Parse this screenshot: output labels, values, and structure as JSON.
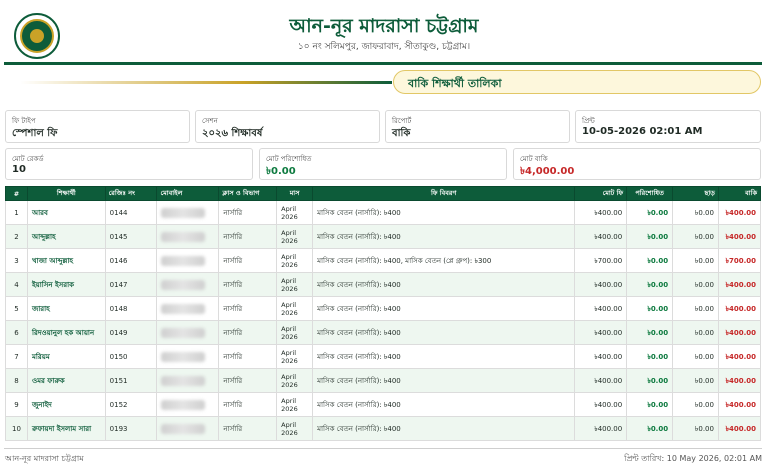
{
  "header": {
    "title": "আন-নূর মাদরাসা চট্টগ্রাম",
    "address": "১০ নং সলিমপুর, জাফরাবাদ, সীতাকুণ্ড, চট্টগ্রাম।"
  },
  "report": {
    "title": "বাকি শিক্ষার্থী তালিকা"
  },
  "filters": {
    "fee_type_label": "ফি টাইপ",
    "fee_type": "স্পেশাল ফি",
    "session_label": "সেশন",
    "session": "২০২৬ শিক্ষাবর্ষ",
    "report_label": "রিপোর্ট",
    "report": "বাকি",
    "print_label": "প্রিন্ট",
    "print_time": "10-05-2026 02:01 AM"
  },
  "summary": {
    "records_label": "মোট রেকর্ড",
    "records": "10",
    "paid_label": "মোট পরিশোধিত",
    "paid": "৳0.00",
    "due_label": "মোট বাকি",
    "due": "৳4,000.00"
  },
  "table": {
    "headers": {
      "no": "#",
      "name": "শিক্ষার্থী",
      "reg": "রেজিঃ নং",
      "mobile": "মোবাইল",
      "class": "ক্লাস ও বিভাগ",
      "month": "মাস",
      "desc": "ফি বিবরণ",
      "total": "মোট ফি",
      "paid": "পরিশোধিত",
      "discount": "ছাড়",
      "due": "বাকি"
    },
    "rows": [
      {
        "no": "1",
        "name": "আরব",
        "reg": "0144",
        "class": "নার্সারি",
        "month": "April 2026",
        "desc": "মাসিক বেতন (নার্সারি): ৳400",
        "total": "৳400.00",
        "paid": "৳0.00",
        "discount": "৳0.00",
        "due": "৳400.00"
      },
      {
        "no": "2",
        "name": "আব্দুল্লাহ",
        "reg": "0145",
        "class": "নার্সারি",
        "month": "April 2026",
        "desc": "মাসিক বেতন (নার্সারি): ৳400",
        "total": "৳400.00",
        "paid": "৳0.00",
        "discount": "৳0.00",
        "due": "৳400.00"
      },
      {
        "no": "3",
        "name": "খাজা আব্দুল্লাহ",
        "reg": "0146",
        "class": "নার্সারি",
        "month": "April 2026",
        "desc": "মাসিক বেতন (নার্সারি): ৳400, মাসিক বেতন (প্লে গ্রুপ): ৳300",
        "total": "৳700.00",
        "paid": "৳0.00",
        "discount": "৳0.00",
        "due": "৳700.00"
      },
      {
        "no": "4",
        "name": "ইয়াসিন ইসরাক",
        "reg": "0147",
        "class": "নার্সারি",
        "month": "April 2026",
        "desc": "মাসিক বেতন (নার্সারি): ৳400",
        "total": "৳400.00",
        "paid": "৳0.00",
        "discount": "৳0.00",
        "due": "৳400.00"
      },
      {
        "no": "5",
        "name": "জারাহ",
        "reg": "0148",
        "class": "নার্সারি",
        "month": "April 2026",
        "desc": "মাসিক বেতন (নার্সারি): ৳400",
        "total": "৳400.00",
        "paid": "৳0.00",
        "discount": "৳0.00",
        "due": "৳400.00"
      },
      {
        "no": "6",
        "name": "রিদওয়ানুল হক আয়ান",
        "reg": "0149",
        "class": "নার্সারি",
        "month": "April 2026",
        "desc": "মাসিক বেতন (নার্সারি): ৳400",
        "total": "৳400.00",
        "paid": "৳0.00",
        "discount": "৳0.00",
        "due": "৳400.00"
      },
      {
        "no": "7",
        "name": "মরিয়ম",
        "reg": "0150",
        "class": "নার্সারি",
        "month": "April 2026",
        "desc": "মাসিক বেতন (নার্সারি): ৳400",
        "total": "৳400.00",
        "paid": "৳0.00",
        "discount": "৳0.00",
        "due": "৳400.00"
      },
      {
        "no": "8",
        "name": "ওমর ফারুক",
        "reg": "0151",
        "class": "নার্সারি",
        "month": "April 2026",
        "desc": "মাসিক বেতন (নার্সারি): ৳400",
        "total": "৳400.00",
        "paid": "৳0.00",
        "discount": "৳0.00",
        "due": "৳400.00"
      },
      {
        "no": "9",
        "name": "জুনাইদ",
        "reg": "0152",
        "class": "নার্সারি",
        "month": "April 2026",
        "desc": "মাসিক বেতন (নার্সারি): ৳400",
        "total": "৳400.00",
        "paid": "৳0.00",
        "discount": "৳0.00",
        "due": "৳400.00"
      },
      {
        "no": "10",
        "name": "রুফায়দা ইসলাম সারা",
        "reg": "0193",
        "class": "নার্সারি",
        "month": "April 2026",
        "desc": "মাসিক বেতন (নার্সারি): ৳400",
        "total": "৳400.00",
        "paid": "৳0.00",
        "discount": "৳0.00",
        "due": "৳400.00"
      }
    ]
  },
  "footer": {
    "left": "আন-নূর মাদরাসা চট্টগ্রাম",
    "right": "প্রিন্ট তারিখ: 10 May 2026, 02:01 AM"
  },
  "colors": {
    "brand": "#0d5c3a",
    "gold": "#c9a227",
    "due": "#c62828",
    "paid": "#0d7a3f"
  }
}
